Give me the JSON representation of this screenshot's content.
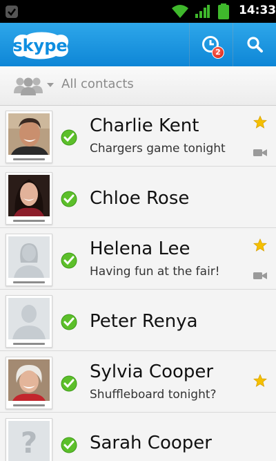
{
  "status_bar": {
    "time": "14:33"
  },
  "action_bar": {
    "logo_text": "skype",
    "recent_badge_count": "2"
  },
  "filter": {
    "label": "All contacts"
  },
  "contacts": [
    {
      "name": "Charlie Kent",
      "mood": "Chargers game tonight",
      "favorite": true,
      "video": true,
      "photo": "photo-man-smiling",
      "status": "online"
    },
    {
      "name": "Chloe Rose",
      "mood": "",
      "favorite": false,
      "video": false,
      "photo": "photo-woman-dark-hair",
      "status": "online"
    },
    {
      "name": "Helena Lee",
      "mood": "Having fun at the fair!",
      "favorite": true,
      "video": true,
      "photo": "default-female-avatar",
      "status": "online"
    },
    {
      "name": "Peter Renya",
      "mood": "",
      "favorite": false,
      "video": false,
      "photo": "default-male-avatar",
      "status": "online"
    },
    {
      "name": "Sylvia Cooper",
      "mood": "Shuffleboard tonight?",
      "favorite": true,
      "video": false,
      "photo": "photo-older-woman",
      "status": "online"
    },
    {
      "name": "Sarah Cooper",
      "mood": "",
      "favorite": false,
      "video": false,
      "photo": "unknown-avatar",
      "status": "online"
    }
  ],
  "colors": {
    "action_bar_top": "#2ea7ea",
    "action_bar_bottom": "#0e86d6",
    "online_green": "#5cbf2a",
    "favorite_star": "#f5c000",
    "badge_red": "#d01b10"
  }
}
